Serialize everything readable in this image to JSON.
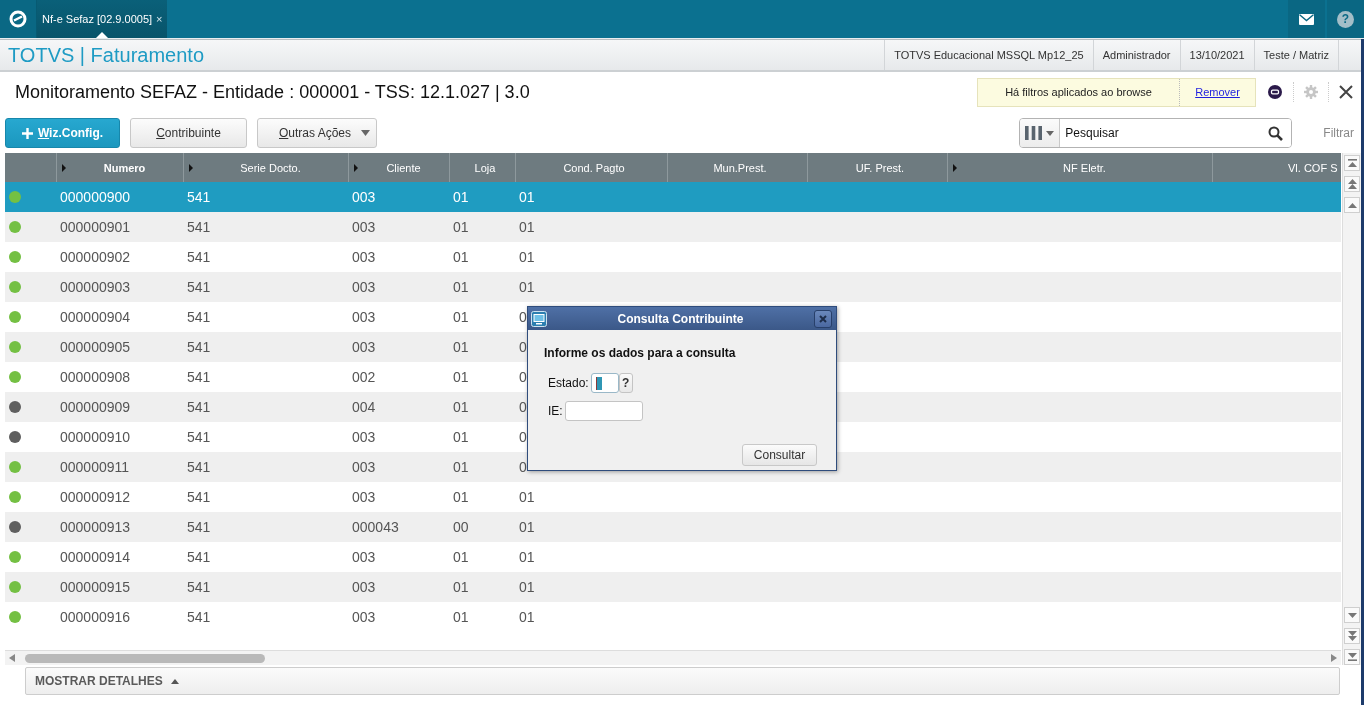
{
  "top_bar": {
    "tabs": [
      {
        "label": "Nf-e Sefaz [02.9.0005]",
        "close": "×",
        "selected": true
      }
    ],
    "help": "?"
  },
  "app_header": {
    "title": "TOTVS | Faturamento",
    "session_info": [
      "TOTVS Educacional MSSQL Mp12_25",
      "Administrador",
      "13/10/2021",
      "Teste / Matriz"
    ]
  },
  "page_header": {
    "title": "Monitoramento SEFAZ - Entidade : 000001 - TSS: 12.1.027 | 3.0",
    "filter_notice": {
      "text": "Há filtros aplicados ao browse",
      "link": "Remover"
    }
  },
  "toolbar": {
    "buttons": [
      {
        "label": "Wiz.Config.",
        "kind": "primary",
        "mnemonic_underlined": true
      },
      {
        "label": "Contribuinte",
        "kind": "default",
        "mnemonic_underlined": true
      },
      {
        "label": "Outras Ações",
        "kind": "menu",
        "mnemonic_underlined": true
      }
    ],
    "search": {
      "placeholder": "Pesquisar"
    },
    "filter_link": "Filtrar"
  },
  "table": {
    "columns": [
      {
        "label": "Numero",
        "expandable": true,
        "sorted": true
      },
      {
        "label": "Serie Docto.",
        "expandable": true,
        "sorted": false
      },
      {
        "label": "Cliente",
        "expandable": true,
        "sorted": false
      },
      {
        "label": "Loja",
        "expandable": false,
        "sorted": false
      },
      {
        "label": "Cond. Pagto",
        "expandable": false,
        "sorted": false
      },
      {
        "label": "Mun.Prest.",
        "expandable": false,
        "sorted": false
      },
      {
        "label": "UF. Prest.",
        "expandable": false,
        "sorted": false
      },
      {
        "label": "NF Eletr.",
        "expandable": true,
        "sorted": false
      },
      {
        "label": "Vl. COF S",
        "expandable": false,
        "sorted": false
      }
    ],
    "rows": [
      {
        "color": "#74c043",
        "selected": true,
        "cells": [
          "000000900",
          "541",
          "003",
          "01",
          "01"
        ]
      },
      {
        "color": "#74c043",
        "selected": false,
        "cells": [
          "000000901",
          "541",
          "003",
          "01",
          "01"
        ]
      },
      {
        "color": "#74c043",
        "selected": false,
        "cells": [
          "000000902",
          "541",
          "003",
          "01",
          "01"
        ]
      },
      {
        "color": "#74c043",
        "selected": false,
        "cells": [
          "000000903",
          "541",
          "003",
          "01",
          "01"
        ]
      },
      {
        "color": "#74c043",
        "selected": false,
        "cells": [
          "000000904",
          "541",
          "003",
          "01",
          "0"
        ]
      },
      {
        "color": "#74c043",
        "selected": false,
        "cells": [
          "000000905",
          "541",
          "003",
          "01",
          "0"
        ]
      },
      {
        "color": "#74c043",
        "selected": false,
        "cells": [
          "000000908",
          "541",
          "002",
          "01",
          "0"
        ]
      },
      {
        "color": "#5f5f5f",
        "selected": false,
        "cells": [
          "000000909",
          "541",
          "004",
          "01",
          "0"
        ]
      },
      {
        "color": "#5f5f5f",
        "selected": false,
        "cells": [
          "000000910",
          "541",
          "003",
          "01",
          "0"
        ]
      },
      {
        "color": "#74c043",
        "selected": false,
        "cells": [
          "000000911",
          "541",
          "003",
          "01",
          "0"
        ]
      },
      {
        "color": "#74c043",
        "selected": false,
        "cells": [
          "000000912",
          "541",
          "003",
          "01",
          "01"
        ]
      },
      {
        "color": "#5f5f5f",
        "selected": false,
        "cells": [
          "000000913",
          "541",
          "000043",
          "00",
          "01"
        ]
      },
      {
        "color": "#74c043",
        "selected": false,
        "cells": [
          "000000914",
          "541",
          "003",
          "01",
          "01"
        ]
      },
      {
        "color": "#74c043",
        "selected": false,
        "cells": [
          "000000915",
          "541",
          "003",
          "01",
          "01"
        ]
      },
      {
        "color": "#74c043",
        "selected": false,
        "cells": [
          "000000916",
          "541",
          "003",
          "01",
          "01"
        ]
      }
    ]
  },
  "dialog": {
    "title": "Consulta Contribuinte",
    "heading": "Informe os dados para a consulta",
    "fields": [
      {
        "label": "Estado:",
        "kind": "lookup",
        "lookup_button": "?",
        "focused": true
      },
      {
        "label": "IE:",
        "kind": "text",
        "focused": false
      }
    ],
    "button": "Consultar"
  },
  "details_toggle": {
    "label": "MOSTRAR DETALHES"
  }
}
